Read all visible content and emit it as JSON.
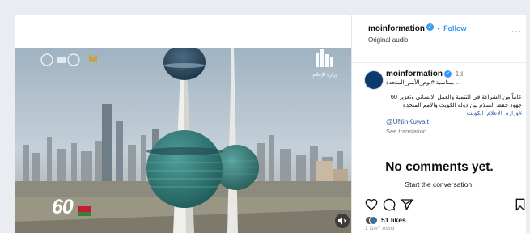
{
  "header": {
    "username": "moinformation",
    "follow_label": "Follow",
    "bullet": "•",
    "audio": "Original audio",
    "more_label": "..."
  },
  "caption": {
    "username": "moinformation",
    "time": "1d",
    "line1": ".. بمناسبة #يوم_الأمم_المتحدة",
    "line2": "عاماً من الشراكة في التنمية والعمل الانساني وتعزيز 60",
    "line3": "جهود حفظ السلام بين دولة الكويت والأمم المتحدة",
    "hashtag": "#وزارة_الاعلام_الكويت",
    "mention": "@UNinKuwait",
    "see_translation": "See translation"
  },
  "comments": {
    "empty_title": "No comments yet.",
    "empty_subtitle": "Start the conversation."
  },
  "post": {
    "likes": "51 likes",
    "date": "1 DAY AGO"
  },
  "video_overlay": {
    "logo_text": "وزارة الإعلام",
    "anniversary_number": "60"
  },
  "icons": {
    "heart": "heart-icon",
    "comment": "comment-icon",
    "share": "share-icon",
    "save": "bookmark-icon",
    "mute": "speaker-muted-icon",
    "verified": "verified-badge-icon"
  },
  "colors": {
    "link_blue": "#3897f0",
    "hashtag_blue": "#2d5a9e",
    "sky": "#b6c6d3",
    "tower_sphere": "#2e7a78"
  }
}
